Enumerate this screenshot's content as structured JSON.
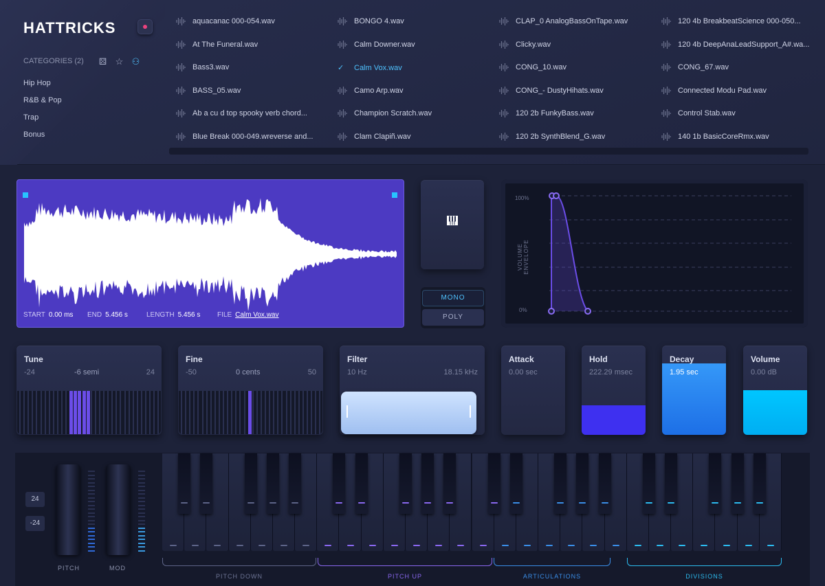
{
  "app": {
    "logo": "HATTRICKS"
  },
  "sidebar": {
    "categories_label": "CATEGORIES (2)",
    "items": [
      "Hip Hop",
      "R&B & Pop",
      "Trap",
      "Bonus"
    ]
  },
  "files": [
    [
      "aquacanac 000-054.wav",
      "At The Funeral.wav",
      "Bass3.wav",
      "BASS_05.wav",
      "Ab a cu d top spooky verb chord...",
      "Blue Break 000-049.wreverse and..."
    ],
    [
      "BONGO 4.wav",
      "Calm Downer.wav",
      "Calm Vox.wav",
      "Camo Arp.wav",
      "Champion Scratch.wav",
      "Clam Clapiñ.wav"
    ],
    [
      "CLAP_0 AnalogBassOnTape.wav",
      "Clicky.wav",
      "CONG_10.wav",
      "CONG_- DustyHihats.wav",
      "120 2b FunkyBass.wav",
      "120 2b SynthBlend_G.wav"
    ],
    [
      "120 4b BreakbeatScience 000-050...",
      "120 4b DeepAnaLeadSupport_A#.wa...",
      "CONG_67.wav",
      "Connected Modu Pad.wav",
      "Control Stab.wav",
      "140 1b BasicCoreRmx.wav"
    ]
  ],
  "selected_file": "Calm Vox.wav",
  "waveform": {
    "start_label": "START",
    "start": "0.00 ms",
    "end_label": "END",
    "end": "5.456 s",
    "length_label": "LENGTH",
    "length": "5.456 s",
    "file_label": "FILE",
    "file": "Calm Vox.wav"
  },
  "mode": {
    "mono": "MONO",
    "poly": "POLY",
    "active": "MONO"
  },
  "envelope": {
    "label": "VOLUME ENVELOPE",
    "top": "100%",
    "bottom": "0%"
  },
  "controls": {
    "tune": {
      "title": "Tune",
      "min": "-24",
      "value": "-6 semi",
      "max": "24"
    },
    "fine": {
      "title": "Fine",
      "min": "-50",
      "value": "0 cents",
      "max": "50"
    },
    "filter": {
      "title": "Filter",
      "min": "10 Hz",
      "max": "18.15 kHz"
    },
    "attack": {
      "title": "Attack",
      "value": "0.00 sec",
      "level": 0
    },
    "hold": {
      "title": "Hold",
      "value": "222.29 msec",
      "level": 0.33
    },
    "decay": {
      "title": "Decay",
      "value": "1.95 sec",
      "level": 0.8
    },
    "volume": {
      "title": "Volume",
      "value": "0.00 dB",
      "level": 0.5
    }
  },
  "wheels": {
    "range_top": "24",
    "range_bottom": "-24",
    "pitch": "PITCH",
    "mod": "MOD"
  },
  "zones": [
    {
      "label": "PITCH DOWN",
      "color": "#5d6488"
    },
    {
      "label": "PITCH UP",
      "color": "#8a68f0"
    },
    {
      "label": "ARTICULATIONS",
      "color": "#3a8ee8"
    },
    {
      "label": "DIVISIONS",
      "color": "#2cbcf0"
    }
  ],
  "colors": {
    "accent": "#4fc3ff",
    "wave_bg": "#4c3ac2",
    "purple": "#6b4de8",
    "blue": "#2f8ef0",
    "cyan": "#00c2ff"
  }
}
